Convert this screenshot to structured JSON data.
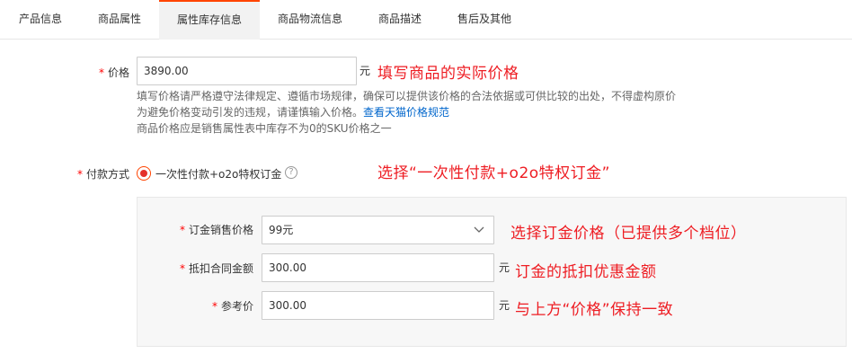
{
  "tabs": [
    {
      "label": "产品信息",
      "active": false
    },
    {
      "label": "商品属性",
      "active": false
    },
    {
      "label": "属性库存信息",
      "active": true
    },
    {
      "label": "商品物流信息",
      "active": false
    },
    {
      "label": "商品描述",
      "active": false
    },
    {
      "label": "售后及其他",
      "active": false
    }
  ],
  "price": {
    "required_mark": "*",
    "label": "价格",
    "value": "3890.00",
    "unit": "元",
    "annotation": "填写商品的实际价格",
    "help_line1": "填写价格请严格遵守法律规定、遵循市场规律，确保可以提供该价格的合法依据或可供比较的出处，不得虚构原价",
    "help_line2_text": "为避免价格变动引发的违规，请谨慎输入价格。",
    "help_line2_link": "查看天猫价格规范",
    "help_line3": "商品价格应是销售属性表中库存不为0的SKU价格之一"
  },
  "payment": {
    "required_mark": "*",
    "label": "付款方式",
    "option_label": "一次性付款+o2o特权订金",
    "help_icon": "question-circle-icon",
    "annotation": "选择“一次性付款+o2o特权订金”"
  },
  "deposit": {
    "sale_price": {
      "required_mark": "*",
      "label": "订金销售价格",
      "value": "99元",
      "annotation": "选择订金价格（已提供多个档位）"
    },
    "contract_amount": {
      "required_mark": "*",
      "label": "抵扣合同金额",
      "value": "300.00",
      "unit": "元",
      "annotation": "订金的抵扣优惠金额"
    },
    "reference_price": {
      "required_mark": "*",
      "label": "参考价",
      "value": "300.00",
      "unit": "元",
      "annotation": "与上方“价格”保持一致"
    }
  },
  "colors": {
    "accent": "#ff4400",
    "annotation": "#ee1d23",
    "link": "#0066cc",
    "required": "#ff0000"
  }
}
